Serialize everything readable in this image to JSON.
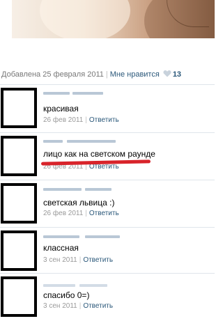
{
  "post": {
    "added_label": "Добавлена 25 февраля 2011",
    "like_label": "Мне нравится",
    "like_count": "13",
    "heart_icon": "heart-icon",
    "heart_color": "#c8d2dc"
  },
  "comments": [
    {
      "text": "красивая",
      "date": "26 фев 2011",
      "reply": "Ответить"
    },
    {
      "text": "лицо как на светском раунде",
      "date": "26 фев 2011",
      "reply": "Ответить",
      "underline_color": "#d8232a"
    },
    {
      "text": "светская львица :)",
      "date": "26 фев 2011",
      "reply": "Ответить"
    },
    {
      "text": "классная",
      "date": "3 сен 2011",
      "reply": "Ответить"
    },
    {
      "text": "спасибо 0=)",
      "date": "3 сен 2011",
      "reply": "Ответить"
    }
  ],
  "colors": {
    "link": "#2b587a",
    "muted": "#999999",
    "divider": "#dfe5eb"
  }
}
